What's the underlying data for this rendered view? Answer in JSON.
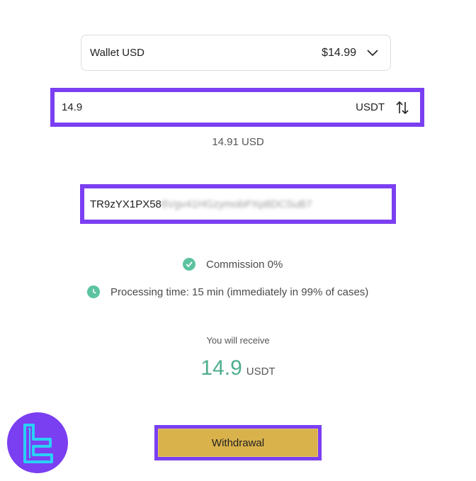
{
  "wallet": {
    "label": "Wallet USD",
    "balance": "$14.99",
    "dropdown_icon": "chevron-down-icon"
  },
  "amount": {
    "value": "14.9",
    "currency": "USDT",
    "swap_icon": "swap-arrows-icon",
    "usd_equivalent": "14.91 USD"
  },
  "address": {
    "visible_part": "TR9zYX1PX58",
    "blurred_part": "6Vgv41HGzymobPXp8DCSuB7"
  },
  "info": {
    "commission": "Commission 0%",
    "processing": "Processing time: 15 min (immediately in 99% of cases)",
    "commission_icon": "check-circle-icon",
    "processing_icon": "clock-icon"
  },
  "receive": {
    "label": "You will receive",
    "value": "14.9",
    "currency": "USDT"
  },
  "actions": {
    "withdraw_label": "Withdrawal"
  },
  "colors": {
    "highlight": "#7b3ff2",
    "accent_green": "#4fae8c",
    "button_gold": "#d9b24c",
    "logo_cyan": "#2ad0f5"
  },
  "logo": {
    "icon": "brand-logo-icon"
  }
}
